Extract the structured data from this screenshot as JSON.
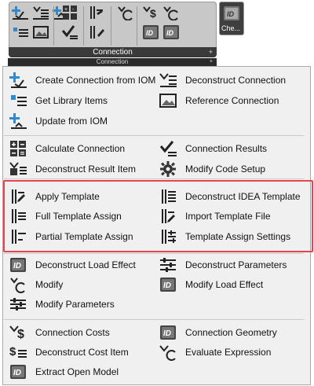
{
  "ribbon": {
    "group_label": "Connection",
    "group_expand": "+",
    "che_label": "Che..."
  },
  "dropdown": {
    "header_label": "Connection",
    "header_expand": "+"
  },
  "menu": {
    "left": [
      {
        "label": "Create Connection from IOM",
        "icon": "create-connection-icon"
      },
      {
        "label": "Get Library Items",
        "icon": "library-items-icon"
      },
      {
        "label": "Update from IOM",
        "icon": "update-iom-icon"
      },
      {
        "label": "Calculate Connection",
        "icon": "calculator-icon"
      },
      {
        "label": "Deconstruct Result Item",
        "icon": "deconstruct-result-icon"
      },
      {
        "label": "Apply Template",
        "icon": "apply-template-icon"
      },
      {
        "label": "Full Template Assign",
        "icon": "full-template-icon"
      },
      {
        "label": "Partial Template Assign",
        "icon": "partial-template-icon"
      },
      {
        "label": "Deconstruct Load Effect",
        "icon": "idea-load-icon"
      },
      {
        "label": "Modify",
        "icon": "modify-icon"
      },
      {
        "label": "Modify Parameters",
        "icon": "sliders-icon"
      },
      {
        "label": "Connection Costs",
        "icon": "costs-icon"
      },
      {
        "label": "Deconstruct Cost Item",
        "icon": "cost-item-icon"
      },
      {
        "label": "Extract Open Model",
        "icon": "open-model-icon"
      }
    ],
    "right": [
      {
        "label": "Deconstruct Connection",
        "icon": "deconstruct-connection-icon"
      },
      {
        "label": "Reference Connection",
        "icon": "reference-connection-icon"
      },
      {
        "label": "Connection Results",
        "icon": "connection-results-icon"
      },
      {
        "label": "Modify Code Setup",
        "icon": "gear-icon"
      },
      {
        "label": "Deconstruct IDEA Template",
        "icon": "deconstruct-template-icon"
      },
      {
        "label": "Import Template File",
        "icon": "import-template-icon"
      },
      {
        "label": "Template Assign Settings",
        "icon": "template-settings-icon"
      },
      {
        "label": "Deconstruct Parameters",
        "icon": "deconstruct-parameters-icon"
      },
      {
        "label": "Modify Load Effect",
        "icon": "modify-load-icon"
      },
      {
        "label": "Connection Geometry",
        "icon": "geometry-icon"
      },
      {
        "label": "Evaluate Expression",
        "icon": "evaluate-icon"
      }
    ]
  },
  "colors": {
    "highlight": "#e8434f",
    "accent_blue": "#2a8ad4",
    "icon_dark": "#2e2e2e",
    "ribbon_bg": "#c8c8c8"
  }
}
